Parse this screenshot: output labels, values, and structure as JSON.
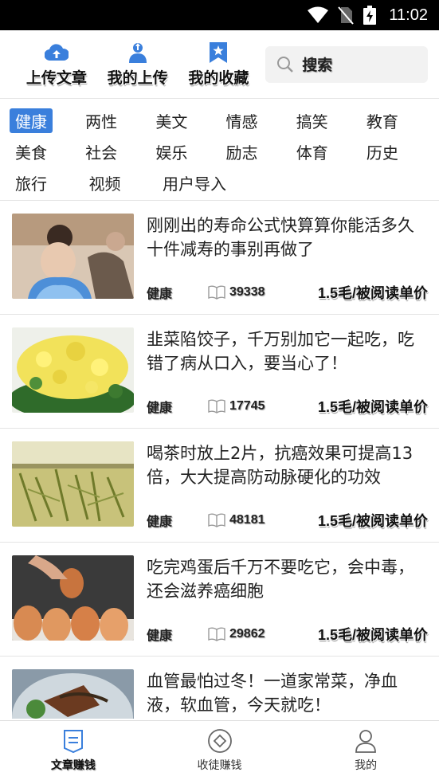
{
  "status_bar": {
    "time": "11:02"
  },
  "top_actions": [
    {
      "label": "上传文章",
      "icon": "cloud-upload-icon"
    },
    {
      "label": "我的上传",
      "icon": "user-upload-icon"
    },
    {
      "label": "我的收藏",
      "icon": "bookmark-star-icon"
    }
  ],
  "search": {
    "placeholder": "搜索"
  },
  "categories": {
    "active": "健康",
    "items": [
      "健康",
      "两性",
      "美文",
      "情感",
      "搞笑",
      "教育",
      "美食",
      "社会",
      "娱乐",
      "励志",
      "体育",
      "历史",
      "旅行",
      "视频",
      "用户导入"
    ]
  },
  "articles": [
    {
      "title": "刚刚出的寿命公式快算算你能活多久十件减寿的事别再做了",
      "tag": "健康",
      "reads": "39338",
      "price": "1.5毛/被阅读单价"
    },
    {
      "title": "韭菜陷饺子，千万别加它一起吃，吃错了病从口入，要当心了！",
      "tag": "健康",
      "reads": "17745",
      "price": "1.5毛/被阅读单价"
    },
    {
      "title": "喝茶时放上2片，抗癌效果可提高13倍，大大提高防动脉硬化的功效",
      "tag": "健康",
      "reads": "48181",
      "price": "1.5毛/被阅读单价"
    },
    {
      "title": "吃完鸡蛋后千万不要吃它，会中毒，还会滋养癌细胞",
      "tag": "健康",
      "reads": "29862",
      "price": "1.5毛/被阅读单价"
    },
    {
      "title": "血管最怕过冬！一道家常菜，净血液，软血管，今天就吃！",
      "tag": "",
      "reads": "",
      "price": ""
    }
  ],
  "bottom_nav": [
    {
      "label": "文章赚钱",
      "icon": "article-icon",
      "active": true
    },
    {
      "label": "收徒赚钱",
      "icon": "diamond-icon",
      "active": false
    },
    {
      "label": "我的",
      "icon": "person-icon",
      "active": false
    }
  ],
  "colors": {
    "accent": "#3a7fdc",
    "status_bar": "#000000"
  }
}
